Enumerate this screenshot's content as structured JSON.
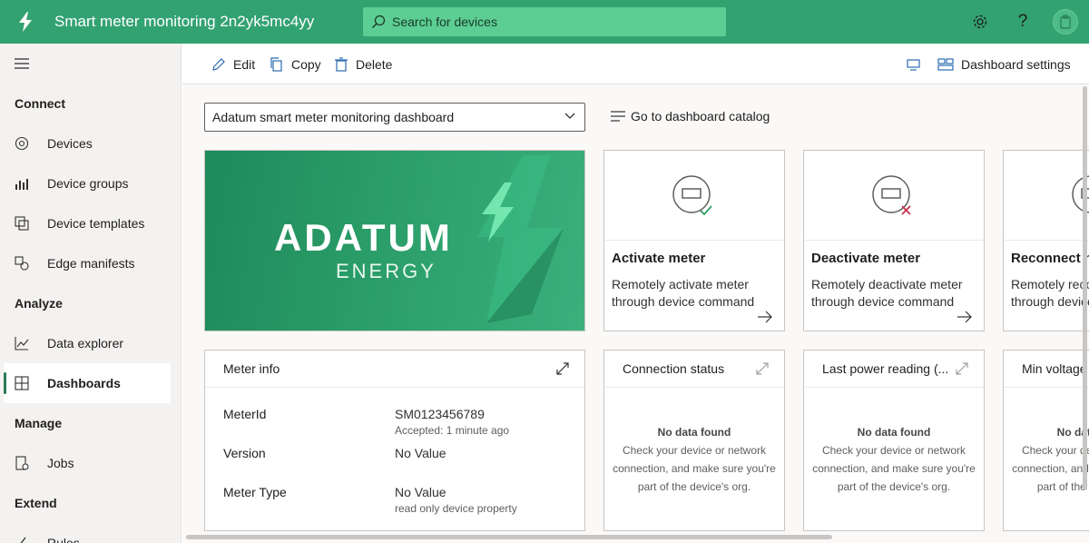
{
  "header": {
    "app_title": "Smart meter monitoring 2n2yk5mc4yy",
    "search_placeholder": "Search for devices",
    "accent_color": "#33a271"
  },
  "sidebar": {
    "sections": [
      {
        "label": "Connect"
      },
      {
        "label": "Analyze"
      },
      {
        "label": "Manage"
      },
      {
        "label": "Extend"
      }
    ],
    "items": [
      {
        "label": "Devices",
        "icon": "devices-icon"
      },
      {
        "label": "Device groups",
        "icon": "device-groups-icon"
      },
      {
        "label": "Device templates",
        "icon": "device-templates-icon"
      },
      {
        "label": "Edge manifests",
        "icon": "edge-manifests-icon"
      },
      {
        "label": "Data explorer",
        "icon": "data-explorer-icon"
      },
      {
        "label": "Dashboards",
        "icon": "dashboards-icon",
        "active": true
      },
      {
        "label": "Jobs",
        "icon": "jobs-icon"
      },
      {
        "label": "Rules",
        "icon": "rules-icon"
      }
    ]
  },
  "toolbar": {
    "edit_label": "Edit",
    "copy_label": "Copy",
    "delete_label": "Delete",
    "dashboard_settings_label": "Dashboard settings"
  },
  "dashboard": {
    "selected": "Adatum smart meter monitoring dashboard",
    "catalog_link": "Go to dashboard catalog",
    "hero": {
      "brand": "ADATUM",
      "sub": "ENERGY"
    },
    "actions": [
      {
        "title": "Activate meter",
        "desc": "Remotely activate meter through device command"
      },
      {
        "title": "Deactivate meter",
        "desc": "Remotely deactivate meter through device command"
      },
      {
        "title": "Reconnect meter",
        "desc": "Remotely reconnect meter through device command"
      }
    ],
    "meter_info": {
      "title": "Meter info",
      "rows": [
        {
          "label": "MeterId",
          "value": "SM0123456789",
          "sub": "Accepted: 1 minute ago"
        },
        {
          "label": "Version",
          "value": "No Value",
          "sub": ""
        },
        {
          "label": "Meter Type",
          "value": "No Value",
          "sub": "read only device property"
        }
      ]
    },
    "tiles": [
      {
        "title": "Connection status"
      },
      {
        "title": "Last power reading (..."
      },
      {
        "title": "Min voltage"
      }
    ],
    "nodata": {
      "title": "No data found",
      "line1": "Check your device or network",
      "line2": "connection, and make sure you're",
      "line3": "part of the device's org."
    }
  }
}
